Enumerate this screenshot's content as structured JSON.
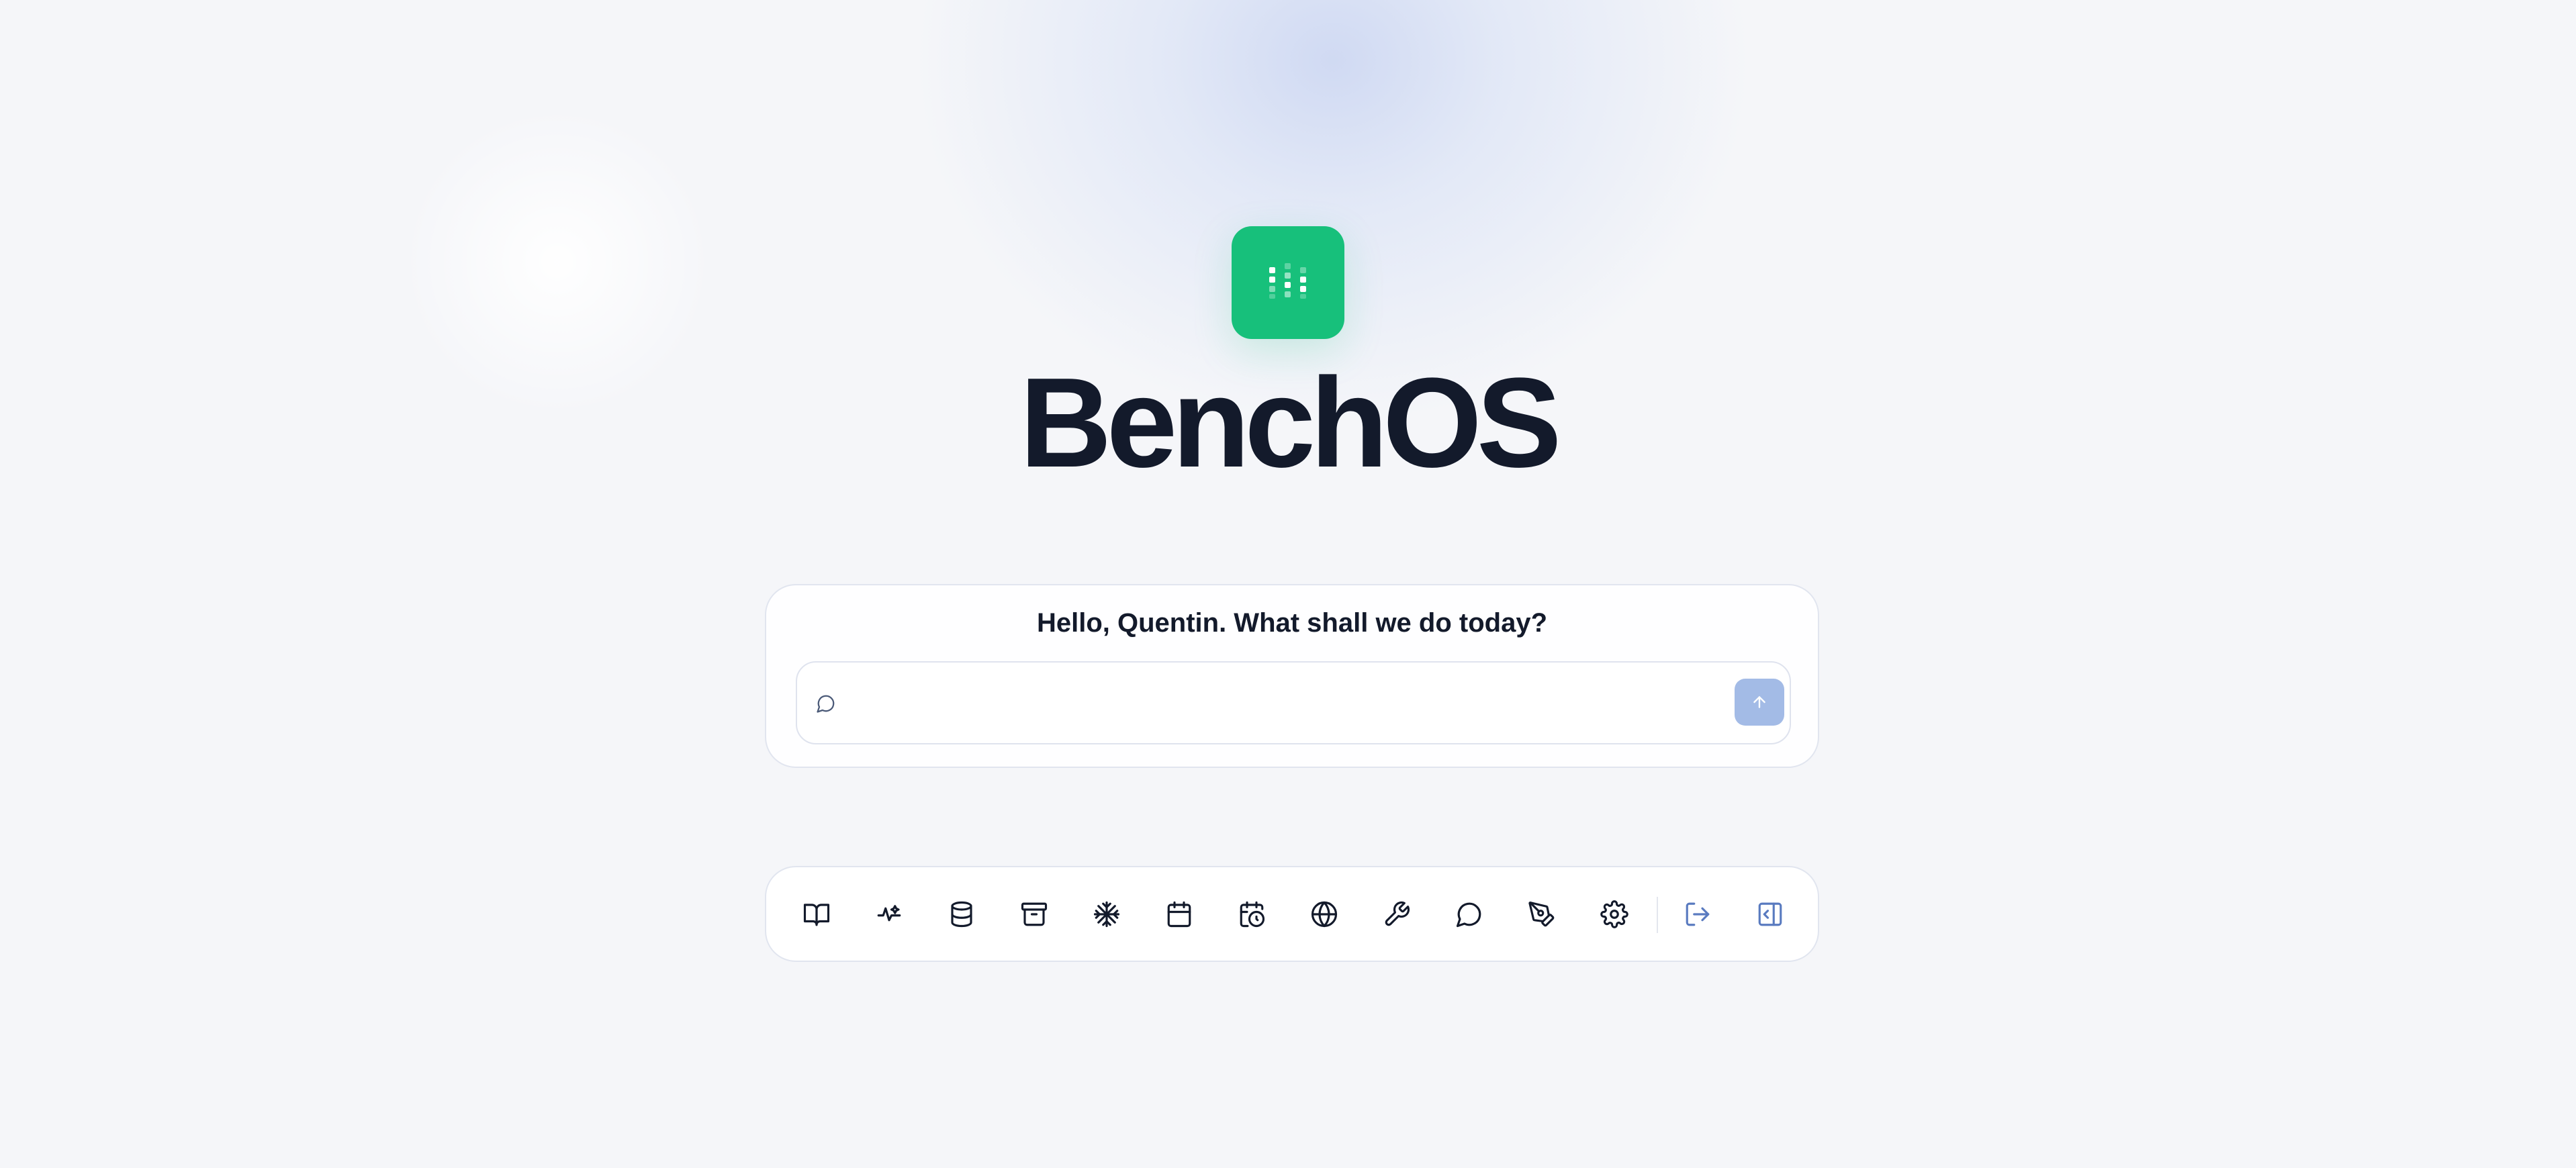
{
  "app": {
    "name": "BenchOS",
    "logo_icon": "benchos-bars-logo",
    "accent_color": "#17c07b",
    "text_color": "#131a2b"
  },
  "prompt": {
    "greeting": "Hello, Quentin. What shall we do today?",
    "input_value": "",
    "input_placeholder": "",
    "input_icon": "chat-bubble-icon",
    "send_icon": "arrow-up-icon",
    "send_color": "#a3bbe6"
  },
  "toolbar": {
    "items": [
      {
        "icon": "book-icon"
      },
      {
        "icon": "sparkles-icon"
      },
      {
        "icon": "database-icon"
      },
      {
        "icon": "archive-icon"
      },
      {
        "icon": "snowflake-icon"
      },
      {
        "icon": "calendar-icon"
      },
      {
        "icon": "calendar-clock-icon"
      },
      {
        "icon": "globe-icon"
      },
      {
        "icon": "wrench-icon"
      },
      {
        "icon": "chat-bubble-icon"
      },
      {
        "icon": "pen-tool-icon"
      },
      {
        "icon": "gear-icon"
      }
    ],
    "secondary_items": [
      {
        "icon": "log-out-icon"
      },
      {
        "icon": "sidebar-toggle-icon"
      }
    ]
  }
}
